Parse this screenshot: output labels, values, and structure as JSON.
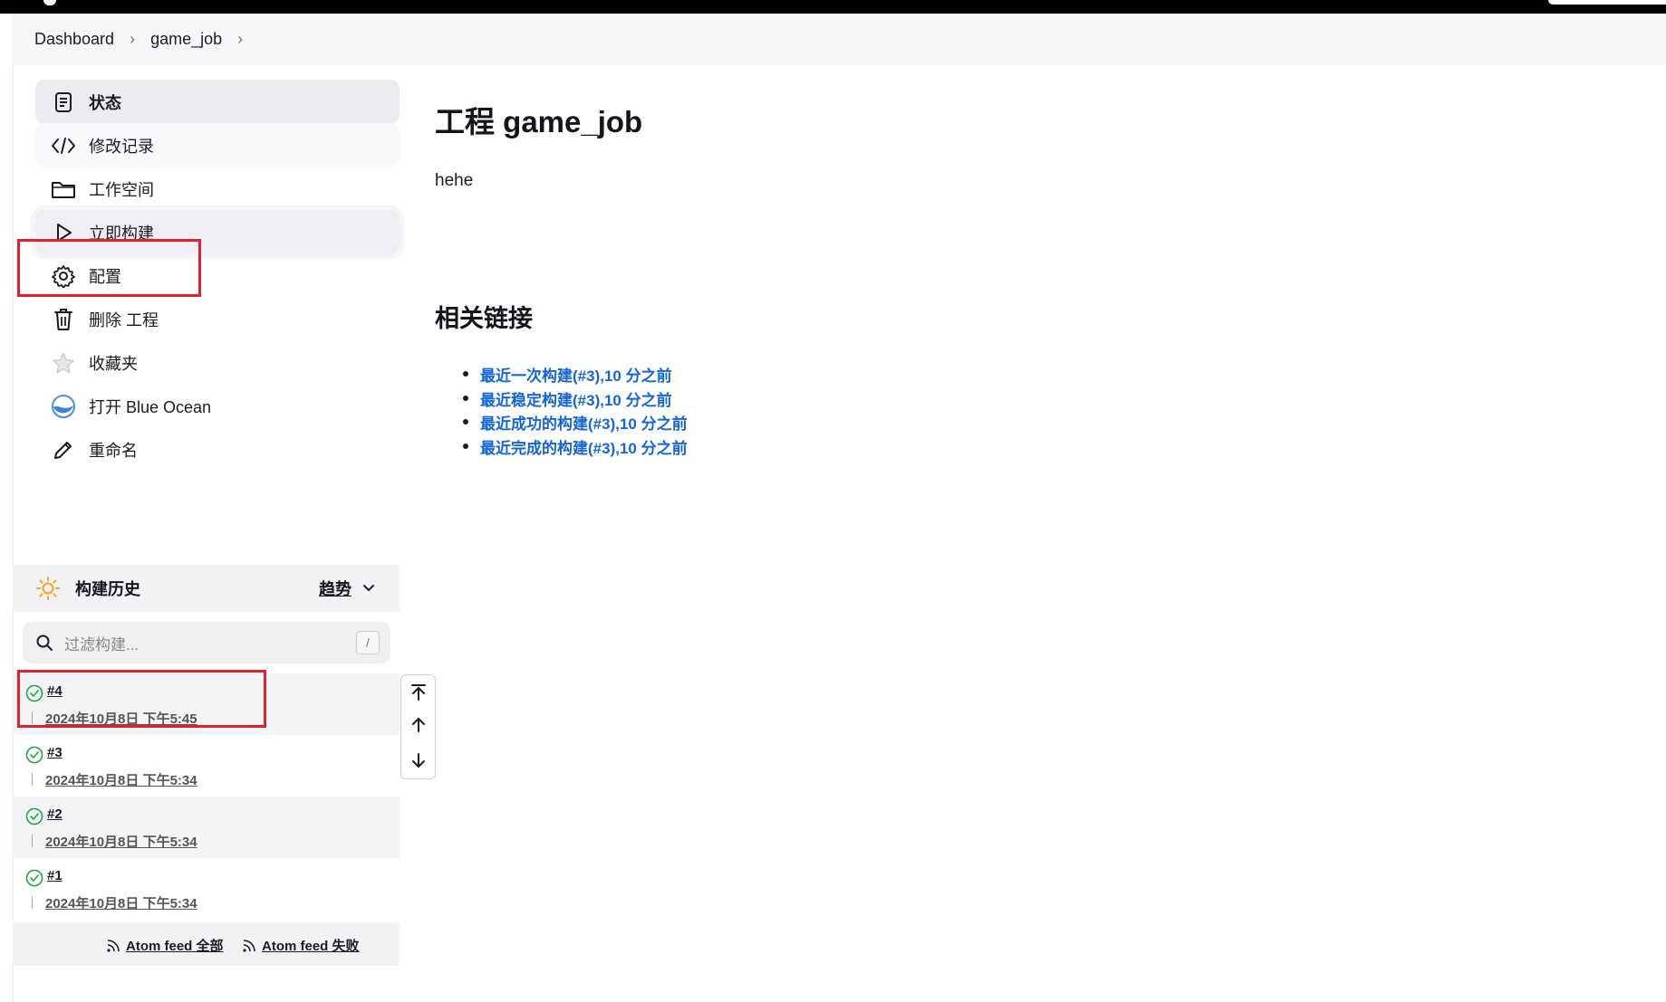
{
  "breadcrumb": {
    "items": [
      "Dashboard",
      "game_job"
    ]
  },
  "tasks": [
    {
      "label": "状态",
      "icon": "status-document-icon"
    },
    {
      "label": "修改记录",
      "icon": "code-icon"
    },
    {
      "label": "工作空间",
      "icon": "folder-icon"
    },
    {
      "label": "立即构建",
      "icon": "play-icon"
    },
    {
      "label": "配置",
      "icon": "gear-icon"
    },
    {
      "label": "删除 工程",
      "icon": "trash-icon"
    },
    {
      "label": "收藏夹",
      "icon": "star-icon"
    },
    {
      "label": "打开 Blue Ocean",
      "icon": "blue-ocean-icon"
    },
    {
      "label": "重命名",
      "icon": "pencil-icon"
    }
  ],
  "build_history": {
    "title": "构建历史",
    "trend_label": "趋势",
    "filter_placeholder": "过滤构建...",
    "filter_shortcut": "/",
    "builds": [
      {
        "number": "#4",
        "time": "2024年10月8日 下午5:45",
        "status": "success"
      },
      {
        "number": "#3",
        "time": "2024年10月8日 下午5:34",
        "status": "success"
      },
      {
        "number": "#2",
        "time": "2024年10月8日 下午5:34",
        "status": "success"
      },
      {
        "number": "#1",
        "time": "2024年10月8日 下午5:34",
        "status": "success"
      }
    ],
    "feeds": {
      "all": "Atom feed 全部",
      "failed": "Atom feed 失败"
    }
  },
  "main": {
    "title": "工程 game_job",
    "description": "hehe",
    "related_heading": "相关链接",
    "links": [
      "最近一次构建(#3),10 分之前",
      "最近稳定构建(#3),10 分之前",
      "最近成功的构建(#3),10 分之前",
      "最近完成的构建(#3),10 分之前"
    ]
  },
  "colors": {
    "link": "#1565d8",
    "success": "#1ea446",
    "highlight": "#e0212b"
  }
}
